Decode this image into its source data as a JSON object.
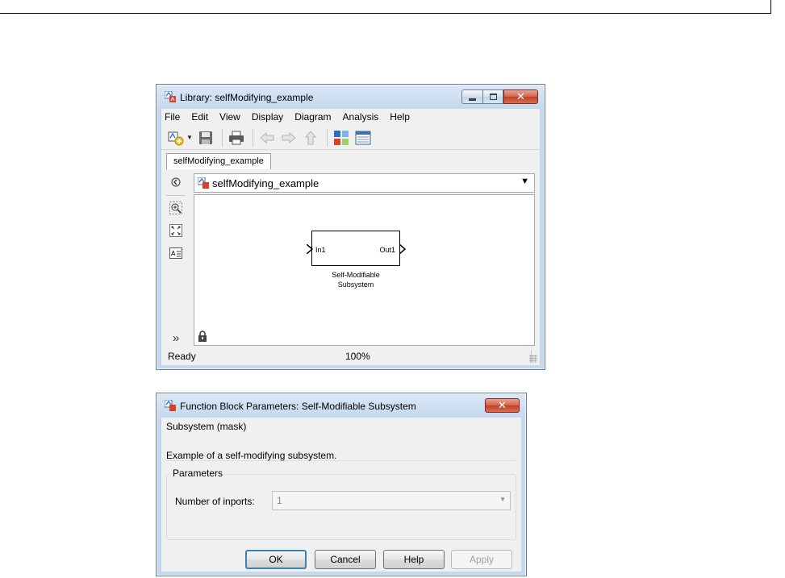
{
  "library_window": {
    "title": "Library: selfModifying_example",
    "menu": [
      "File",
      "Edit",
      "View",
      "Display",
      "Diagram",
      "Analysis",
      "Help"
    ],
    "tab_label": "selfModifying_example",
    "address": "selfModifying_example",
    "block": {
      "in_port": "In1",
      "out_port": "Out1",
      "caption_line1": "Self-Modifiable",
      "caption_line2": "Subsystem"
    },
    "status": "Ready",
    "zoom": "100%"
  },
  "dialog": {
    "title": "Function Block Parameters: Self-Modifiable Subsystem",
    "mask_group_title": "Subsystem (mask)",
    "description": "Example of a self-modifying subsystem.",
    "params_group_title": "Parameters",
    "inports_label": "Number of inports:",
    "inports_value": "1",
    "buttons": {
      "ok": "OK",
      "cancel": "Cancel",
      "help": "Help",
      "apply": "Apply"
    }
  },
  "colors": {
    "title_gradient_top": "#dbe8f6",
    "title_gradient": "#c5d8ee",
    "close_button": "#c33f24",
    "default_button_border": "#3c7fb1"
  },
  "icons": [
    "simulink-model-icon",
    "new-model-icon",
    "save-icon",
    "print-icon",
    "back-icon",
    "forward-icon",
    "up-icon",
    "library-browser-icon",
    "model-explorer-icon",
    "hide-browser-icon",
    "zoom-icon",
    "fit-view-icon",
    "annotation-icon",
    "expand-palette-icon",
    "lock-icon"
  ]
}
